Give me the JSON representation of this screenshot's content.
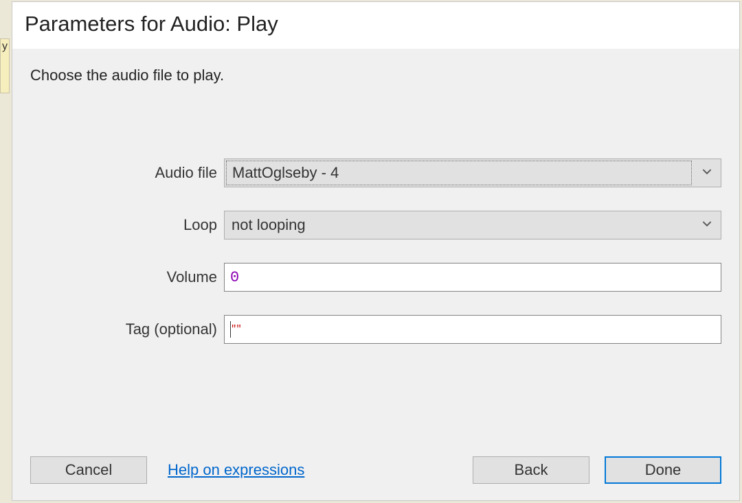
{
  "dialog": {
    "title": "Parameters for Audio: Play",
    "instruction": "Choose the audio file to play."
  },
  "form": {
    "audio_file": {
      "label": "Audio file",
      "value": "MattOglseby - 4"
    },
    "loop": {
      "label": "Loop",
      "value": "not looping"
    },
    "volume": {
      "label": "Volume",
      "value": "0"
    },
    "tag": {
      "label": "Tag (optional)",
      "value": "\"\""
    }
  },
  "buttons": {
    "cancel": "Cancel",
    "help_link": "Help on expressions",
    "back": "Back",
    "done": "Done"
  },
  "background_tab_char": "y"
}
